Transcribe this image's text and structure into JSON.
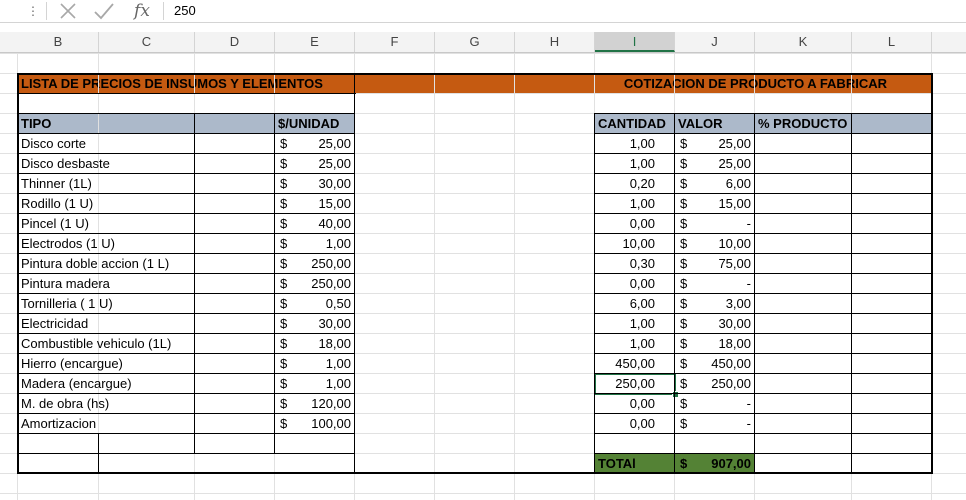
{
  "formula_bar": {
    "menu_icon": "vertical-dots-icon",
    "cancel_icon": "close-icon",
    "enter_icon": "check-icon",
    "function_icon": "fx-icon",
    "function_label": "fx",
    "value": "250"
  },
  "columns": [
    {
      "label": "B"
    },
    {
      "label": "C"
    },
    {
      "label": "D"
    },
    {
      "label": "E"
    },
    {
      "label": "F"
    },
    {
      "label": "G"
    },
    {
      "label": "H"
    },
    {
      "label": "I",
      "selected": true
    },
    {
      "label": "J"
    },
    {
      "label": "K"
    },
    {
      "label": "L"
    }
  ],
  "left_table": {
    "title": "LISTA DE PRECIOS DE INSUMOS Y ELEMENTOS",
    "header_tipo": "TIPO",
    "header_unit": "$/UNIDAD",
    "currency": "$",
    "items": [
      {
        "tipo": "Disco corte",
        "price": "25,00"
      },
      {
        "tipo": "Disco desbaste",
        "price": "25,00"
      },
      {
        "tipo": "Thinner (1L)",
        "price": "30,00"
      },
      {
        "tipo": "Rodillo (1 U)",
        "price": "15,00"
      },
      {
        "tipo": "Pincel (1 U)",
        "price": "40,00"
      },
      {
        "tipo": "Electrodos (1 U)",
        "price": "1,00"
      },
      {
        "tipo": "Pintura doble accion (1 L)",
        "price": "250,00"
      },
      {
        "tipo": "Pintura madera",
        "price": "250,00"
      },
      {
        "tipo": "Tornilleria ( 1 U)",
        "price": "0,50"
      },
      {
        "tipo": "Electricidad",
        "price": "30,00"
      },
      {
        "tipo": "Combustible vehiculo (1L)",
        "price": "18,00"
      },
      {
        "tipo": "Hierro (encargue)",
        "price": "1,00"
      },
      {
        "tipo": "Madera (encargue)",
        "price": "1,00"
      },
      {
        "tipo": "M. de obra (hs)",
        "price": "120,00"
      },
      {
        "tipo": "Amortizacion",
        "price": "100,00"
      }
    ]
  },
  "right_table": {
    "title": "COTIZACION DE PRODUCTO A FABRICAR",
    "header_cantidad": "CANTIDAD",
    "header_valor": "VALOR",
    "header_pct": "% PRODUCTO",
    "currency": "$",
    "rows": [
      {
        "cantidad": "1,00",
        "valor": "25,00"
      },
      {
        "cantidad": "1,00",
        "valor": "25,00"
      },
      {
        "cantidad": "0,20",
        "valor": "6,00"
      },
      {
        "cantidad": "1,00",
        "valor": "15,00"
      },
      {
        "cantidad": "0,00",
        "valor": "-"
      },
      {
        "cantidad": "10,00",
        "valor": "10,00"
      },
      {
        "cantidad": "0,30",
        "valor": "75,00"
      },
      {
        "cantidad": "0,00",
        "valor": "-"
      },
      {
        "cantidad": "6,00",
        "valor": "3,00"
      },
      {
        "cantidad": "1,00",
        "valor": "30,00"
      },
      {
        "cantidad": "1,00",
        "valor": "18,00"
      },
      {
        "cantidad": "450,00",
        "valor": "450,00"
      },
      {
        "cantidad": "250,00",
        "valor": "250,00"
      },
      {
        "cantidad": "0,00",
        "valor": "-"
      },
      {
        "cantidad": "0,00",
        "valor": "-"
      }
    ],
    "total_label": "TOTAl",
    "total_currency": "$",
    "total_value": "907,00"
  }
}
